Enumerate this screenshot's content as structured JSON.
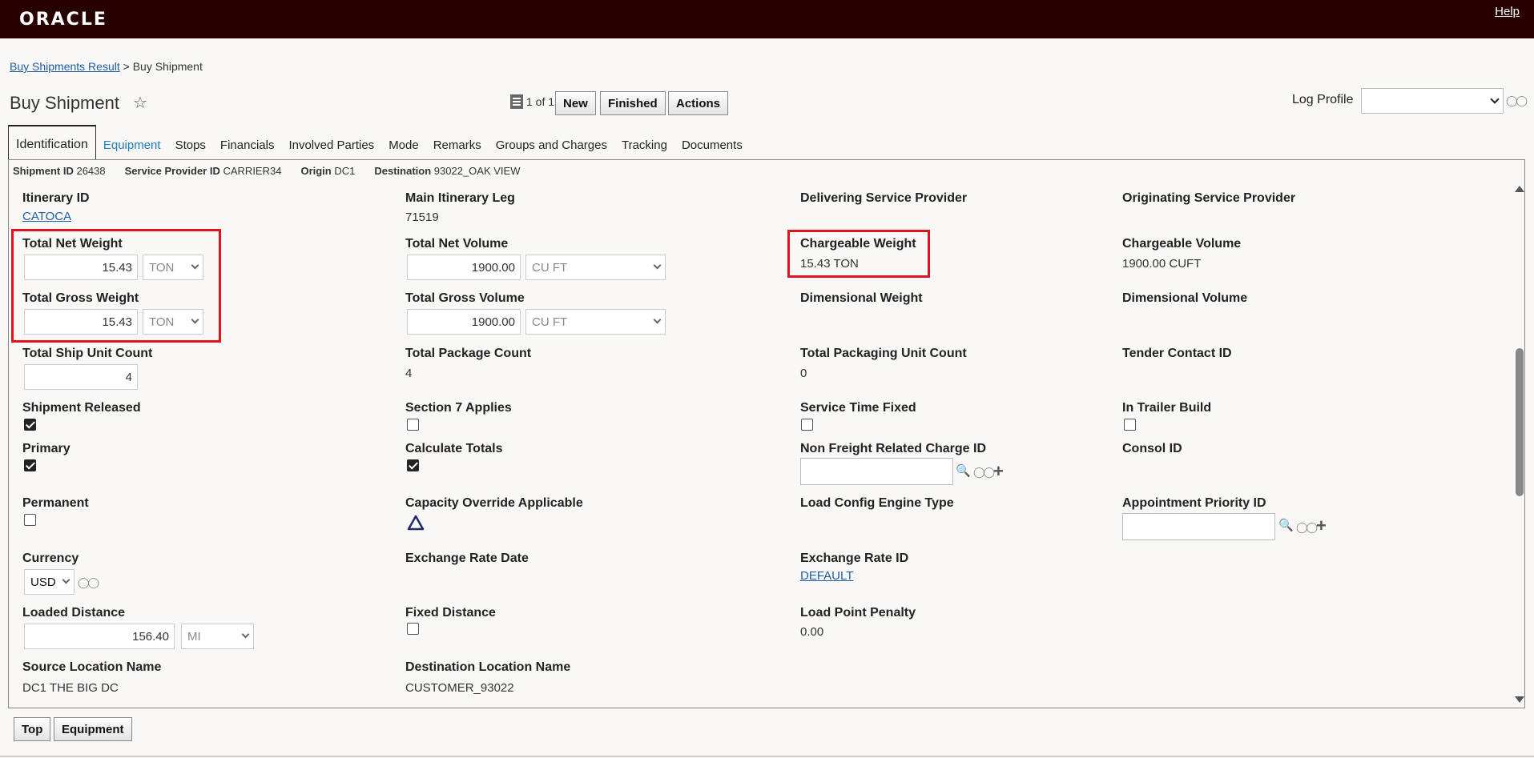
{
  "header": {
    "logo": "ORACLE",
    "help": "Help"
  },
  "breadcrumb": {
    "link": "Buy Shipments Result",
    "separator": ">",
    "current": "Buy Shipment"
  },
  "page": {
    "title": "Buy Shipment",
    "star": "☆"
  },
  "pager": {
    "text": "1 of 1"
  },
  "toolbar": {
    "new": "New",
    "finished": "Finished",
    "actions": "Actions"
  },
  "log_profile": {
    "label": "Log Profile",
    "value": ""
  },
  "tabs": [
    {
      "label": "Identification",
      "active": true
    },
    {
      "label": "Equipment",
      "link": true
    },
    {
      "label": "Stops"
    },
    {
      "label": "Financials"
    },
    {
      "label": "Involved Parties"
    },
    {
      "label": "Mode"
    },
    {
      "label": "Remarks"
    },
    {
      "label": "Groups and Charges"
    },
    {
      "label": "Tracking"
    },
    {
      "label": "Documents"
    }
  ],
  "summary": {
    "shipment_id_label": "Shipment ID",
    "shipment_id": "26438",
    "provider_label": "Service Provider ID",
    "provider": "CARRIER34",
    "origin_label": "Origin",
    "origin": "DC1",
    "destination_label": "Destination",
    "destination": "93022_OAK VIEW"
  },
  "fields": {
    "itinerary_id": {
      "label": "Itinerary ID",
      "value": "CATOCA"
    },
    "main_itinerary_leg": {
      "label": "Main Itinerary Leg",
      "value": "71519"
    },
    "delivering_sp": {
      "label": "Delivering Service Provider"
    },
    "originating_sp": {
      "label": "Originating Service Provider"
    },
    "total_net_weight": {
      "label": "Total Net Weight",
      "value": "15.43",
      "unit": "TON"
    },
    "total_net_volume": {
      "label": "Total Net Volume",
      "value": "1900.00",
      "unit": "CU FT"
    },
    "chargeable_weight": {
      "label": "Chargeable Weight",
      "value": "15.43 TON"
    },
    "chargeable_volume": {
      "label": "Chargeable Volume",
      "value": "1900.00 CUFT"
    },
    "total_gross_weight": {
      "label": "Total Gross Weight",
      "value": "15.43",
      "unit": "TON"
    },
    "total_gross_volume": {
      "label": "Total Gross Volume",
      "value": "1900.00",
      "unit": "CU FT"
    },
    "dimensional_weight": {
      "label": "Dimensional Weight"
    },
    "dimensional_volume": {
      "label": "Dimensional Volume"
    },
    "total_ship_unit_count": {
      "label": "Total Ship Unit Count",
      "value": "4"
    },
    "total_package_count": {
      "label": "Total Package Count",
      "value": "4"
    },
    "total_packaging_unit_count": {
      "label": "Total Packaging Unit Count",
      "value": "0"
    },
    "tender_contact_id": {
      "label": "Tender Contact ID"
    },
    "shipment_released": {
      "label": "Shipment Released",
      "checked": true
    },
    "section7_applies": {
      "label": "Section 7 Applies",
      "checked": false
    },
    "service_time_fixed": {
      "label": "Service Time Fixed",
      "checked": false
    },
    "in_trailer_build": {
      "label": "In Trailer Build",
      "checked": false
    },
    "primary": {
      "label": "Primary",
      "checked": true
    },
    "calculate_totals": {
      "label": "Calculate Totals",
      "checked": true
    },
    "non_freight_charge_id": {
      "label": "Non Freight Related Charge ID",
      "value": ""
    },
    "consol_id": {
      "label": "Consol ID"
    },
    "permanent": {
      "label": "Permanent",
      "checked": false
    },
    "capacity_override": {
      "label": "Capacity Override Applicable"
    },
    "load_config_engine_type": {
      "label": "Load Config Engine Type"
    },
    "appointment_priority_id": {
      "label": "Appointment Priority ID",
      "value": ""
    },
    "currency": {
      "label": "Currency",
      "value": "USD"
    },
    "exchange_rate_date": {
      "label": "Exchange Rate Date"
    },
    "exchange_rate_id": {
      "label": "Exchange Rate ID",
      "value": "DEFAULT"
    },
    "loaded_distance": {
      "label": "Loaded Distance",
      "value": "156.40",
      "unit": "MI"
    },
    "fixed_distance": {
      "label": "Fixed Distance",
      "checked": false
    },
    "load_point_penalty": {
      "label": "Load Point Penalty",
      "value": "0.00"
    },
    "source_location_name": {
      "label": "Source Location Name",
      "value": "DC1 THE BIG DC"
    },
    "destination_location_name": {
      "label": "Destination Location Name",
      "value": "CUSTOMER_93022"
    }
  },
  "bottom": {
    "top": "Top",
    "equipment": "Equipment"
  },
  "icons": {
    "glasses": "glasses-icon",
    "search": "magnifier-icon",
    "add": "plus-icon",
    "warning": "triangle-icon"
  },
  "colors": {
    "header_bg": "#290000",
    "highlight": "#e0141e",
    "link": "#1f5fa0"
  }
}
